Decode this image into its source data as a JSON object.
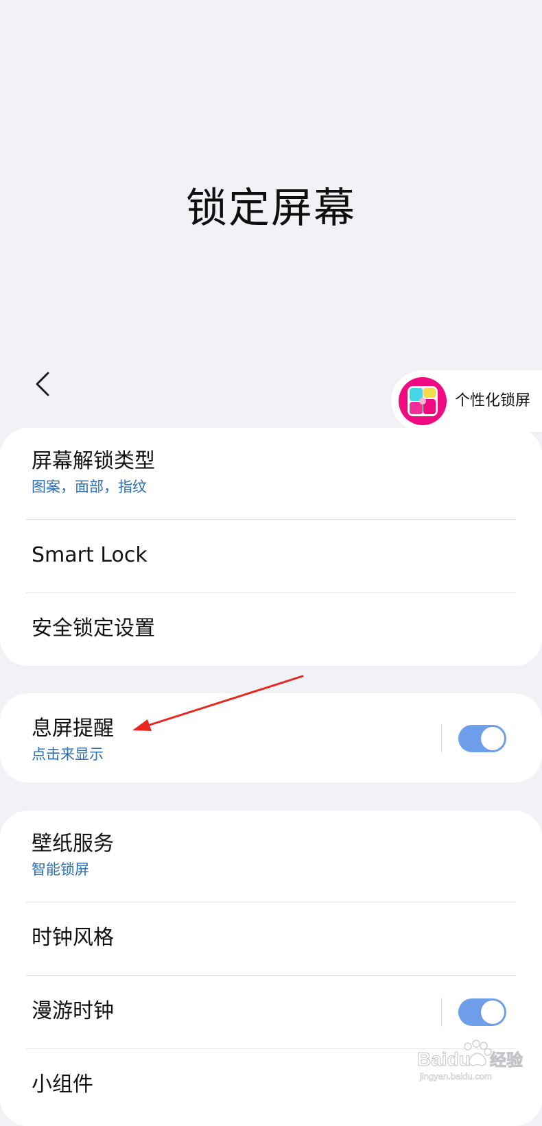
{
  "page": {
    "title": "锁定屏幕"
  },
  "floating": {
    "label": "个性化锁屏",
    "icon": "personalize-lock-screen-icon",
    "icon_colors": [
      "#ef0a82",
      "#43d6e6",
      "#f4dc4b",
      "#ffffff"
    ]
  },
  "nav": {
    "back_icon": "chevron-left-icon"
  },
  "group1": [
    {
      "title": "屏幕解锁类型",
      "subtitle": "图案，面部，指纹"
    },
    {
      "title": "Smart Lock",
      "subtitle": ""
    },
    {
      "title": "安全锁定设置",
      "subtitle": ""
    }
  ],
  "group2": [
    {
      "title": "息屏提醒",
      "subtitle": "点击来显示",
      "toggle": true
    }
  ],
  "group3": [
    {
      "title": "壁纸服务",
      "subtitle": "智能锁屏"
    },
    {
      "title": "时钟风格",
      "subtitle": ""
    },
    {
      "title": "漫游时钟",
      "subtitle": "",
      "toggle": true
    },
    {
      "title": "小组件",
      "subtitle": ""
    }
  ],
  "watermark": {
    "brand": "Baidu",
    "brand_cn": "经验",
    "url": "jingyan.baidu.com"
  },
  "colors": {
    "background": "#f1f2f6",
    "card": "#ffffff",
    "subtitle": "#2d6fb4",
    "toggle_on": "#6e9eea",
    "annotation_arrow": "#e8281e"
  }
}
